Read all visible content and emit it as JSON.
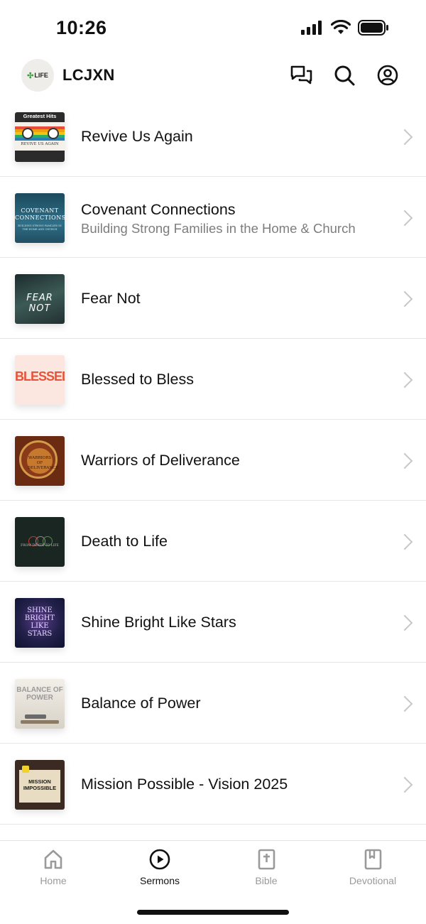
{
  "status": {
    "time": "10:26"
  },
  "header": {
    "church_name": "LCJXN",
    "logo_text": "LIFE"
  },
  "sermons": [
    {
      "title": "Revive Us Again",
      "subtitle": "",
      "art_text": "Greatest Hits",
      "art_subtext": "REVIVE US AGAIN"
    },
    {
      "title": "Covenant Connections",
      "subtitle": "Building Strong Families in the Home & Church",
      "art_text": "COVENANT CONNECTIONS",
      "art_subtext": "BUILDING STRONG FAMILIES IN THE HOME AND CHURCH"
    },
    {
      "title": "Fear Not",
      "subtitle": "",
      "art_text": "FEAR NOT",
      "art_subtext": ""
    },
    {
      "title": "Blessed to Bless",
      "subtitle": "",
      "art_text": "BLESSED",
      "art_subtext": ""
    },
    {
      "title": "Warriors of Deliverance",
      "subtitle": "",
      "art_text": "WARRIORS OF DELIVERANCE",
      "art_subtext": ""
    },
    {
      "title": "Death to Life",
      "subtitle": "",
      "art_text": "FROM DEATH TO LIFE",
      "art_subtext": ""
    },
    {
      "title": "Shine Bright Like Stars",
      "subtitle": "",
      "art_text": "SHINE BRIGHT LIKE STARS",
      "art_subtext": ""
    },
    {
      "title": "Balance of Power",
      "subtitle": "",
      "art_text": "BALANCE OF POWER",
      "art_subtext": ""
    },
    {
      "title": "Mission Possible - Vision 2025",
      "subtitle": "",
      "art_text": "MISSION IMPOSSIBLE",
      "art_subtext": ""
    }
  ],
  "tabs": [
    {
      "label": "Home",
      "icon": "home-icon",
      "active": false
    },
    {
      "label": "Sermons",
      "icon": "play-circle-icon",
      "active": true
    },
    {
      "label": "Bible",
      "icon": "bible-icon",
      "active": false
    },
    {
      "label": "Devotional",
      "icon": "bookmark-book-icon",
      "active": false
    }
  ],
  "colors": {
    "active_tab": "#111111",
    "inactive_tab": "#9a9a9a",
    "divider": "#e6e6e6"
  }
}
